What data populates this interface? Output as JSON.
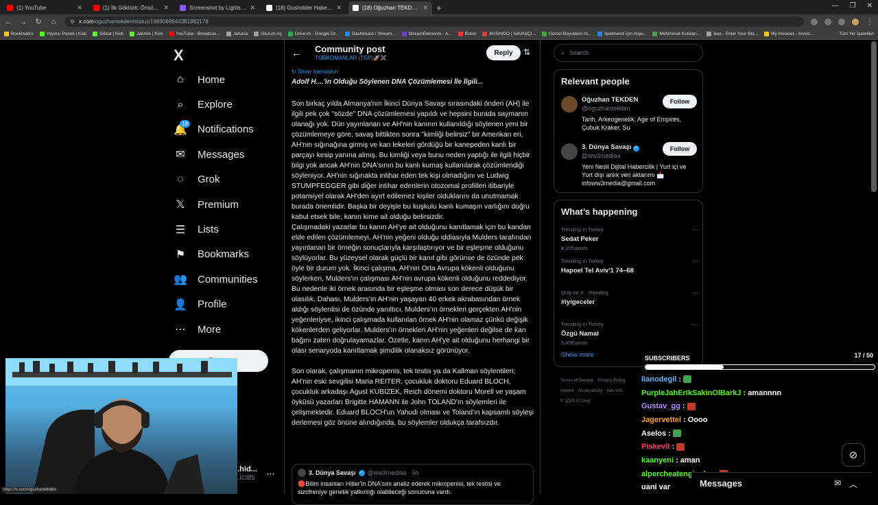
{
  "browser": {
    "tabs": [
      {
        "title": "(1) YouTube",
        "color": "#ff0000",
        "active": false
      },
      {
        "title": "(1) İlk Göktürk: Önsöz | İlk Tarih",
        "color": "#ff0000",
        "active": false
      },
      {
        "title": "Screenshot by Lightshot",
        "color": "#8a5cf6",
        "active": false
      },
      {
        "title": "(18) Gusholder Haber Bülteni on X",
        "color": "#ffffff",
        "active": false
      },
      {
        "title": "(18) Oğuzhan TEKDEN on X: \"A...",
        "color": "#ffffff",
        "active": true
      }
    ],
    "new_tab": "+",
    "window_controls": [
      "—",
      "❐",
      "✕"
    ],
    "url_domain": "x.com",
    "url_path": "/oguzhantekden/status/1989089644361982178",
    "bookmarks": [
      {
        "label": "Bookmarks",
        "color": "#f5c518"
      },
      {
        "label": "Yayıncı Paneli | Kick",
        "color": "#53fc18"
      },
      {
        "label": "Gözat | Kick",
        "color": "#53fc18"
      },
      {
        "label": "Jahmin | Kick",
        "color": "#53fc18"
      },
      {
        "label": "YouTube - Broadcas...",
        "color": "#ff0000"
      },
      {
        "label": "Jaharia",
        "color": "#a0a0a0"
      },
      {
        "label": "Oturum Aç",
        "color": "#a0a0a0"
      },
      {
        "label": "Drive'ım - Google Dr...",
        "color": "#34a853"
      },
      {
        "label": "Dashboard / Stream...",
        "color": "#1e88e5"
      },
      {
        "label": "StreamElements - A...",
        "color": "#6f42c1"
      },
      {
        "label": "Botrix",
        "color": "#e53935"
      },
      {
        "label": "BUSHIDO | SAVAŞÇI...",
        "color": "#e53935"
      },
      {
        "label": "Görsel Boyutlanrı N...",
        "color": "#43a047"
      },
      {
        "label": "İşletmeniz için Alışv...",
        "color": "#1e88e5"
      },
      {
        "label": "Mühimmat Kutuları...",
        "color": "#43a047"
      },
      {
        "label": "ikas - Enter Your Sto...",
        "color": "#a0a0a0"
      },
      {
        "label": "My Invoices - Invoic...",
        "color": "#f5c518"
      }
    ],
    "all_bookmarks": "Tüm Yer İşaretleri",
    "status_url": "https://x.com/oguzhantekden"
  },
  "nav": {
    "logo": "X",
    "items": [
      {
        "label": "Home",
        "icon": "home-icon",
        "glyph": "⌂"
      },
      {
        "label": "Explore",
        "icon": "search-icon",
        "glyph": "⌕"
      },
      {
        "label": "Notifications",
        "icon": "bell-icon",
        "glyph": "🔔",
        "badge": "18"
      },
      {
        "label": "Messages",
        "icon": "envelope-icon",
        "glyph": "✉"
      },
      {
        "label": "Grok",
        "icon": "grok-icon",
        "glyph": "◌"
      },
      {
        "label": "Premium",
        "icon": "x-premium-icon",
        "glyph": "𝕏"
      },
      {
        "label": "Lists",
        "icon": "list-icon",
        "glyph": "☰"
      },
      {
        "label": "Bookmarks",
        "icon": "bookmark-icon",
        "glyph": "⚑"
      },
      {
        "label": "Communities",
        "icon": "people-icon",
        "glyph": "👥"
      },
      {
        "label": "Profile",
        "icon": "person-icon",
        "glyph": "👤"
      },
      {
        "label": "More",
        "icon": "more-circle-icon",
        "glyph": "⋯"
      }
    ],
    "post_button": "Post",
    "account_name": "...hid...",
    "account_handle": "...icats"
  },
  "post": {
    "header_title": "Community post",
    "community": "TÜRKOMANLAR (TGP)🚀✖️",
    "reply_label": "Reply",
    "show_translation": "Show translation",
    "title": "Adolf H....'in Olduğu Söylenen DNA Çözümlemesi İle İlgili...",
    "paragraphs": [
      "Son birkaç yılda Almanya'nın İkinci Dünya Savaşı sırasındaki önderi (AH) ile ilgili pek çok \"sözde\" DNA çözümlemesi yapıldı ve hepsini burada saymanın olanağı yok. Dün yayınlanan ve AH'nin kanının kullanıldığı söylenen yeni bir çözümlemeye göre, savaş bittikten sonra \"kimliği belirsiz\" bir Amerikan eri, AH'nin sığınağına girmiş ve kan lekeleri gördüğü bir kanepeden kanlı bir parçayı kesip yanına almış. Bu kimliği veya bunu neden yaptığı ile ilgili hiçbir bilgi yok ancak AH'nin DNA'sının bu kanlı kumaş kullanılarak çözümlendiği söyleniyor. AH'nin sığınakta intihar eden tek kişi olmadığını ve Ludwig STUMPFEGGER gibi diğer intihar edenlerin otozomal profilleri itibariyle potansiyel olarak AH'den ayırt edilemez kişiler olduklarını da unutmamak burada önemlidir. Başka bir deyişle bu kuşkulu kanlı kumaşın varlığını doğru kabul etsek bile, kanın kime ait olduğu belirsizdir.\nÇalışmadaki yazarlar bu kanın AH'ye ait olduğunu kanıtlamak için bu kandan elde edilen çözümlemeyi, AH'nin yeğeni olduğu iddiasıyla Mulders tarafından yayınlanan bir örneğin sonuçlarıyla karşılaştırıyor ve bir eşleşme olduğunu söylüyorlar. Bu yüzeysel olarak güçlü bir kanıt gibi görünse de özünde pek öyle bir durum yok. İkinci çalışma, AH'nin Orta Avrupa kökenli olduğunu söylerken, Mulders'ın çalışması AH'nin avrupa kökenli olduğunu reddediyor. Bu nedenle iki örnek arasında bir eşleşme olması son derece düşük bir olasılık. Dahası, Mulders'ın AH'nin yaşayan 40 erkek akrabasından örnek aldığı söylentisi de özünde yanıltıcı. Mulders'ın örnekleri gerçekten AH'nin yeğenleriyse, ikinci çalışmada kullanılan örnek AH'nin olamaz çünkü değişik kökenlerden geliyorlar. Mulders'ın örnekleri AH'nin yeğenleri değilse de kan bağını zaten doğrulayamazlar. Özetle, kanın AH'ye ait olduğunu herhangi bir olası senaryoda kanıtlamak şimdilik olanaksız görünüyor.",
      "Son olarak, çalışmanın mikropenis, tek testis ya da Kallman söylentileri; AH'nin eski sevgilisi Maria REITER, çocukluk doktoru Eduard BLOCH, çocukluk arkadaşı Agust KUBIZEK, Reich dönemi doktoru Morell ve yaşam öyküsü yazarları Brigitte HAMANN ile John TOLAND'ın söylemleri ile çelişmektedir. Eduard BLOCH'un Yahudi olması ve Toland'ın kapsamlı söyleşi derlemesi göz önüne alındığında, bu söylemler oldukça tarafsızdır."
    ],
    "quote": {
      "name": "3. Dünya Savaşı",
      "handle": "@ww3mediaa · 5h",
      "text": "🔴Bilim insanları Hitler'in DNA'sını analiz ederek mikropenisi, tek testisi ve sizofreniye genetik yatkınlığı olabileceği sonucuna vardı."
    }
  },
  "sidebar": {
    "search_placeholder": "Search",
    "relevant_title": "Relevant people",
    "people": [
      {
        "name": "Oğuzhan TEKDEN",
        "handle": "@oguzhantekden",
        "bio": "Tarih, Arkeogenetik, Age of Empires, Çubuk Kraker, Su",
        "follow": "Follow",
        "verified": false
      },
      {
        "name": "3. Dünya Savaşı",
        "handle": "@ww3mediaa",
        "bio": "Yeni Nesil Dijital Habercilik | Yurt içi ve Yurt dışı anlık veri aktarımı 📩 infoww3media@gmail.com",
        "follow": "Follow",
        "verified": true
      }
    ],
    "happening_title": "What’s happening",
    "trends": [
      {
        "context": "Trending in Turkey",
        "title": "Sedat Peker",
        "count": "8,105 posts"
      },
      {
        "context": "Trending in Turkey",
        "title": "Hapoel Tel Aviv'1 74–68",
        "count": ""
      },
      {
        "context": "Only on X · Trending",
        "title": "#iyigeceler",
        "count": ""
      },
      {
        "context": "Trending in Turkey",
        "title": "Özgü Namal",
        "count": "5,450 posts"
      }
    ],
    "show_more": "Show more",
    "footer": [
      "Terms of Service",
      "Privacy Policy",
      "Imprint",
      "Accessibility",
      "Ads info",
      "© 2025 X Corp."
    ]
  },
  "overlay": {
    "subs_label": "SUBSCRIBERS",
    "subs_count": "17 / 50",
    "subs_progress": 0.34,
    "chat": [
      {
        "user": "lianodegil",
        "color": "#5bb8ff",
        "msg": "",
        "emote": "#3fa34d"
      },
      {
        "user": "PurpleJahErIkSakinOlBarkJ",
        "color": "#53fc18",
        "msg": "amannnn",
        "emote": ""
      },
      {
        "user": "Gustav_gg",
        "color": "#b48cff",
        "msg": "",
        "emote": "#c0392b"
      },
      {
        "user": "Jagervettel",
        "color": "#ff9f1a",
        "msg": "Oooo",
        "emote": ""
      },
      {
        "user": "Aselos",
        "color": "#ffffff",
        "msg": "",
        "emote": "#3fa34d"
      },
      {
        "user": "Piskevit",
        "color": "#ff3b6b",
        "msg": "",
        "emote": "#c0392b"
      },
      {
        "user": "kaanyeni",
        "color": "#53fc18",
        "msg": "aman",
        "emote": ""
      },
      {
        "user": "alpercheatengineler",
        "color": "#53fc18",
        "msg": "",
        "emote": "#c0392b"
      },
      {
        "user": "uani var",
        "color": "#ffffff",
        "msg": "",
        "emote": ""
      }
    ],
    "messages_dock": "Messages"
  }
}
